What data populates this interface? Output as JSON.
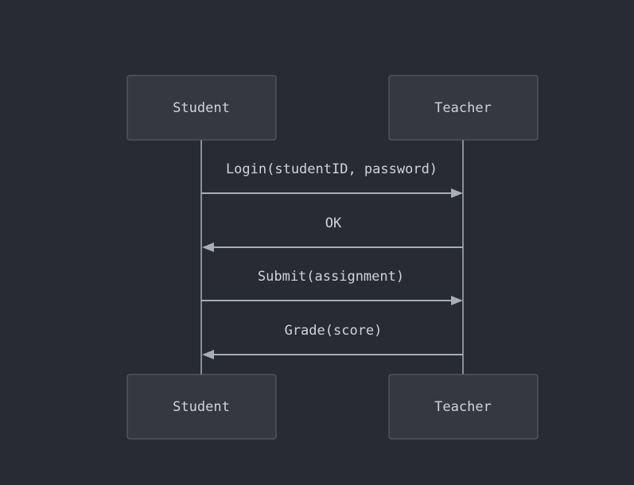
{
  "actors": [
    {
      "id": "student",
      "label": "Student"
    },
    {
      "id": "teacher",
      "label": "Teacher"
    }
  ],
  "messages": [
    {
      "from": "student",
      "to": "teacher",
      "label": "Login(studentID, password)"
    },
    {
      "from": "teacher",
      "to": "student",
      "label": "OK"
    },
    {
      "from": "student",
      "to": "teacher",
      "label": "Submit(assignment)"
    },
    {
      "from": "teacher",
      "to": "student",
      "label": "Grade(score)"
    }
  ],
  "colors": {
    "background": "#282b33",
    "box_fill": "#353841",
    "box_stroke": "#5e6370",
    "line": "#a8adb8",
    "text": "#d0d3da"
  }
}
